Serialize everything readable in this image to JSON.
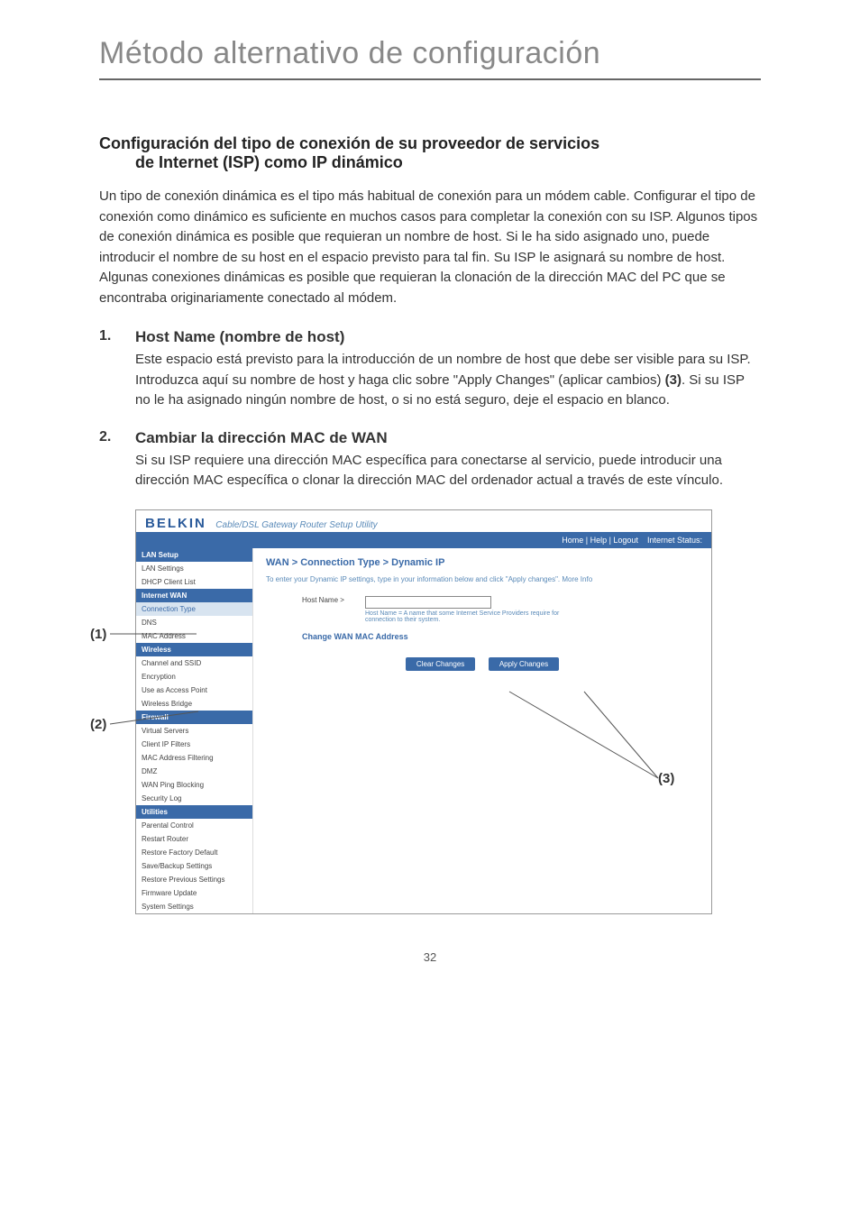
{
  "page": {
    "title": "Método alternativo de configuración",
    "number": "32"
  },
  "section": {
    "heading_main": "Configuración del tipo de conexión de su proveedor de servicios",
    "heading_sub": "de Internet (ISP) como IP dinámico",
    "intro": "Un tipo de conexión dinámica es el tipo más habitual de conexión para un módem cable. Configurar el tipo de conexión como dinámico es suficiente en muchos casos para completar la conexión con su ISP. Algunos tipos de conexión dinámica es posible que requieran un nombre de host. Si le ha sido asignado uno, puede introducir el nombre de su host en el espacio previsto para tal fin. Su ISP le asignará su nombre de host. Algunas conexiones dinámicas es posible que requieran la clonación de la dirección MAC del PC que se encontraba originariamente conectado al módem."
  },
  "items": [
    {
      "num": "1.",
      "title": "Host Name (nombre de host)",
      "body_pre": "Este espacio está previsto para la introducción de un nombre de host que debe ser visible para su ISP. Introduzca aquí su nombre de host y haga clic sobre \"Apply Changes\" (aplicar cambios) ",
      "body_bold": "(3)",
      "body_post": ". Si su ISP no le ha asignado ningún nombre de host, o si no está seguro, deje el espacio en blanco."
    },
    {
      "num": "2.",
      "title": "Cambiar la dirección MAC de WAN",
      "body_pre": "Si su ISP requiere una dirección MAC específica para conectarse al servicio, puede introducir una dirección MAC específica o clonar la dirección MAC del ordenador actual a través de este vínculo.",
      "body_bold": "",
      "body_post": ""
    }
  ],
  "callouts": {
    "c1": "(1)",
    "c2": "(2)",
    "c3": "(3)"
  },
  "screenshot": {
    "logo": "BELKIN",
    "tagline": "Cable/DSL Gateway Router Setup Utility",
    "bar_links": "Home | Help | Logout",
    "bar_status": "Internet Status:",
    "nav": {
      "cat1": "LAN Setup",
      "lan_settings": "LAN Settings",
      "dhcp": "DHCP Client List",
      "cat2": "Internet WAN",
      "conn_type": "Connection Type",
      "dns": "DNS",
      "mac_addr": "MAC Address",
      "cat3": "Wireless",
      "chan_ssid": "Channel and SSID",
      "enc": "Encryption",
      "use_ap": "Use as Access Point",
      "wbridge": "Wireless Bridge",
      "cat4": "Firewall",
      "vs": "Virtual Servers",
      "cif": "Client IP Filters",
      "maf": "MAC Address Filtering",
      "dmz": "DMZ",
      "wpb": "WAN Ping Blocking",
      "slog": "Security Log",
      "cat5": "Utilities",
      "parental": "Parental Control",
      "restart": "Restart Router",
      "rfd": "Restore Factory Default",
      "sbs": "Save/Backup Settings",
      "rps": "Restore Previous Settings",
      "fw": "Firmware Update",
      "ss": "System Settings"
    },
    "main": {
      "crumb": "WAN > Connection Type > Dynamic IP",
      "info": "To enter your Dynamic IP settings, type in your information below and click \"Apply changes\". More Info",
      "host_label": "Host Name >",
      "host_hint": "Host Name = A name that some Internet Service Providers require for connection to their system.",
      "mac_link": "Change WAN MAC Address",
      "btn_clear": "Clear Changes",
      "btn_apply": "Apply Changes"
    }
  }
}
